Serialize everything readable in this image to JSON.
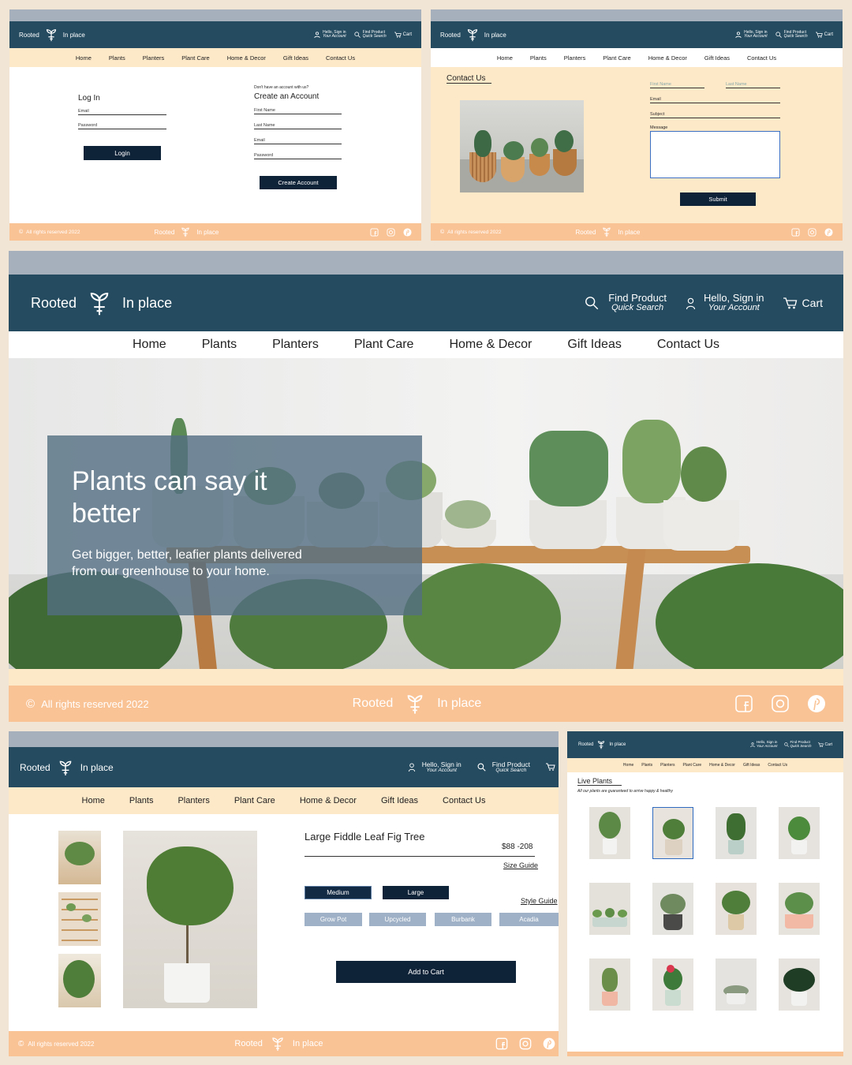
{
  "brand": {
    "left": "Rooted",
    "right": "In place"
  },
  "account": {
    "hello": "Hello, Sign in",
    "sub": "Your Account"
  },
  "find": {
    "title": "Find Product",
    "sub": "Quick Search"
  },
  "cart": {
    "label": "Cart"
  },
  "nav": [
    "Home",
    "Plants",
    "Planters",
    "Plant Care",
    "Home & Decor",
    "Gift Ideas",
    "Contact Us"
  ],
  "footer": {
    "rights": "All rights reserved 2022"
  },
  "login": {
    "title": "Log In",
    "email": "Email",
    "password": "Password",
    "button": "Login"
  },
  "signup": {
    "prompt": "Don't have an account with us?",
    "title": "Create an Account",
    "first": "First Name",
    "last": "Last Name",
    "email": "Email",
    "password": "Password",
    "button": "Create Account"
  },
  "contact": {
    "title": "Contact Us",
    "first": "First Name",
    "last": "Last Name",
    "email": "Email",
    "subject": "Subject",
    "message": "Message",
    "button": "Submit"
  },
  "hero": {
    "headline": "Plants can say it better",
    "subtext": "Get bigger, better, leafier plants delivered from our greenhouse to your home."
  },
  "product": {
    "name": "Large Fiddle Leaf Fig Tree",
    "price": "$88 -208",
    "size_guide": "Size Guide",
    "sizes": [
      "Medium",
      "Large"
    ],
    "style_guide": "Style Guide",
    "styles": [
      "Grow Pot",
      "Upcycled",
      "Burbank",
      "Acadia"
    ],
    "add_to_cart": "Add to Cart"
  },
  "listing": {
    "title": "Live Plants",
    "subtitle": "All our plants are guaranteed to arrive happy & healthy"
  },
  "colors": {
    "header": "#244b60",
    "topbar": "#a6b0bd",
    "footer": "#fac396",
    "nav_bg": "#fde8c8",
    "button": "#0e2238",
    "style_option": "#9fb1c6"
  }
}
